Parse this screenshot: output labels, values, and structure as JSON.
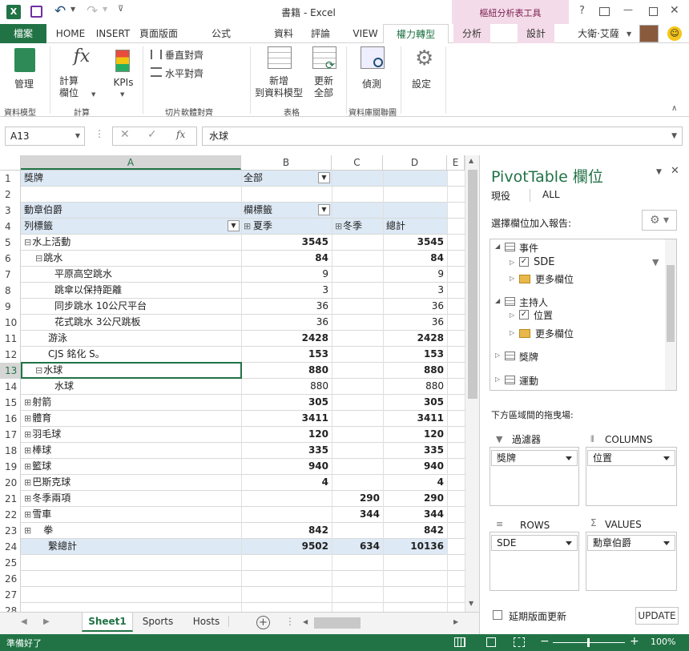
{
  "title": {
    "app_title": "書籍 - Excel",
    "context_tab": "樞紐分析表工具",
    "help": "?",
    "min": "—",
    "close": "✕"
  },
  "tabs": {
    "file": "檔案",
    "home": "HOME",
    "insert": "INSERT",
    "layout": "頁面版面",
    "formulas": "公式",
    "data": "資料",
    "review": "評論",
    "view": "VIEW",
    "powerpivot": "權力轉型",
    "analyze": "分析",
    "design": "設計",
    "user": "大衛·艾薩"
  },
  "ribbon": {
    "manage": "管理",
    "calc_line1": "計算",
    "calc_line2": "欄位",
    "kpis": "KPIs",
    "vert": "垂直對齊",
    "horz": "水平對齊",
    "add_line1": "新增",
    "add_line2": "到資料模型",
    "refresh_line1": "更新",
    "refresh_line2": "全部",
    "detect": "偵測",
    "settings": "設定",
    "g_model": "資料模型",
    "g_calc": "計算",
    "g_slicer": "切片軟體對齊",
    "g_table": "表格",
    "g_rel": "資料庫關聯圖"
  },
  "formula_bar": {
    "name_box": "A13",
    "content": "水球",
    "fx": "fx"
  },
  "columns": [
    "A",
    "B",
    "C",
    "D",
    "E"
  ],
  "rows": [
    {
      "n": "1",
      "a": "獎牌",
      "b": "全部",
      "c": "",
      "d": ""
    },
    {
      "n": "2",
      "a": "",
      "b": "",
      "c": "",
      "d": ""
    },
    {
      "n": "3",
      "a": "動章伯爵",
      "b": "欄標籤",
      "c": "",
      "d": ""
    },
    {
      "n": "4",
      "a": "列標籤",
      "b": "夏季",
      "c": "冬季",
      "d": "總計"
    },
    {
      "n": "5",
      "a": "水上活動",
      "b": "3545",
      "c": "",
      "d": "3545"
    },
    {
      "n": "6",
      "a": "跳水",
      "b": "84",
      "c": "",
      "d": "84"
    },
    {
      "n": "7",
      "a": "平原高空跳水",
      "b": "9",
      "c": "",
      "d": "9"
    },
    {
      "n": "8",
      "a": "跳傘以保持距離",
      "b": "3",
      "c": "",
      "d": "3"
    },
    {
      "n": "9",
      "a": "同步跳水 10公尺平台",
      "b": "36",
      "c": "",
      "d": "36"
    },
    {
      "n": "10",
      "a": "花式跳水 3公尺跳板",
      "b": "36",
      "c": "",
      "d": "36"
    },
    {
      "n": "11",
      "a": "游泳",
      "b": "2428",
      "c": "",
      "d": "2428"
    },
    {
      "n": "12",
      "a": "CJS 銘化 S。",
      "b": "153",
      "c": "",
      "d": "153"
    },
    {
      "n": "13",
      "a": "水球",
      "b": "880",
      "c": "",
      "d": "880"
    },
    {
      "n": "14",
      "a": "水球",
      "b": "880",
      "c": "",
      "d": "880"
    },
    {
      "n": "15",
      "a": "射箭",
      "b": "305",
      "c": "",
      "d": "305"
    },
    {
      "n": "16",
      "a": "體育",
      "b": "3411",
      "c": "",
      "d": "3411"
    },
    {
      "n": "17",
      "a": "羽毛球",
      "b": "120",
      "c": "",
      "d": "120"
    },
    {
      "n": "18",
      "a": "棒球",
      "b": "335",
      "c": "",
      "d": "335"
    },
    {
      "n": "19",
      "a": "籃球",
      "b": "940",
      "c": "",
      "d": "940"
    },
    {
      "n": "20",
      "a": "巴斯克球",
      "b": "4",
      "c": "",
      "d": "4"
    },
    {
      "n": "21",
      "a": "冬季兩項",
      "b": "",
      "c": "290",
      "d": "290"
    },
    {
      "n": "22",
      "a": "雪車",
      "b": "",
      "c": "344",
      "d": "344"
    },
    {
      "n": "23",
      "a": "拳",
      "b": "842",
      "c": "",
      "d": "842"
    },
    {
      "n": "24",
      "a": "繫總計",
      "b": "9502",
      "c": "634",
      "d": "10136"
    },
    {
      "n": "25",
      "a": "",
      "b": "",
      "c": "",
      "d": ""
    },
    {
      "n": "26",
      "a": "",
      "b": "",
      "c": "",
      "d": ""
    },
    {
      "n": "27",
      "a": "",
      "b": "",
      "c": "",
      "d": ""
    },
    {
      "n": "28",
      "a": "",
      "b": "",
      "c": "",
      "d": ""
    }
  ],
  "sheets": [
    "Sheet1",
    "Sports",
    "Hosts"
  ],
  "panel": {
    "title": "PivotTable",
    "title2": "欄位",
    "tab_active": "現役",
    "tab_all": "ALL",
    "choose": "選擇欄位加入報告:",
    "fields": {
      "events": "事件",
      "sde": "SDE",
      "more1": "更多欄位",
      "hosts": "主持人",
      "location": "位置",
      "more2": "更多欄位",
      "medals": "獎牌",
      "sports": "運動"
    },
    "drag": "下方區域間的拖曳場:",
    "filters": "過濾器",
    "columns": "COLUMNS",
    "rows": "ROWS",
    "values": "VALUES",
    "filter_item": "獎牌",
    "column_item": "位置",
    "row_item": "SDE",
    "value_item": "勳章伯爵",
    "defer": "延期版面更新",
    "update": "UPDATE"
  },
  "status": {
    "ready": "準備好了",
    "zoom": "100%"
  },
  "colors": {
    "accent": "#217346",
    "pivot_header": "#dde9f5",
    "selection": "#217346",
    "context": "#f4dbe9"
  }
}
